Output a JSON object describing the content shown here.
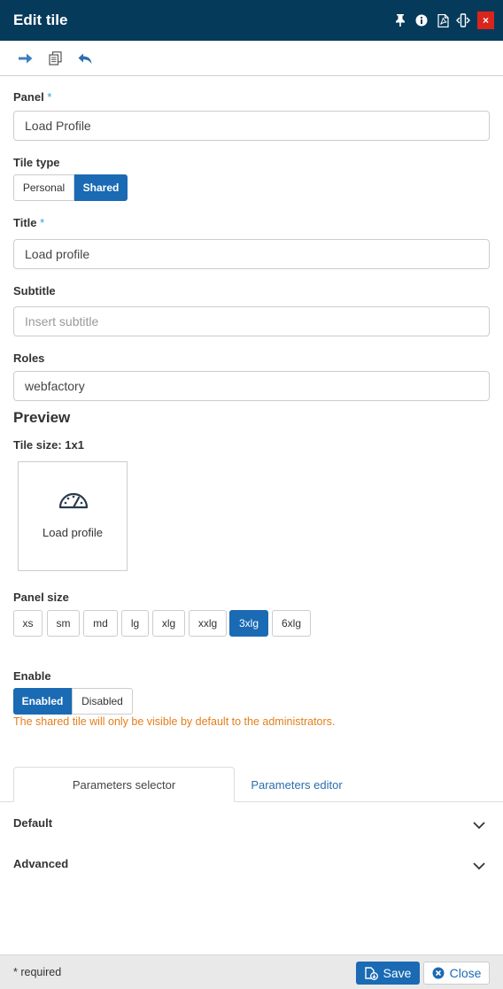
{
  "header": {
    "title": "Edit tile",
    "close_label": "×",
    "icons": [
      "pin-icon",
      "info-icon",
      "pdf-icon",
      "expand-width-icon"
    ]
  },
  "toolbar": {
    "icons": [
      "arrow-right-icon",
      "copy-icon",
      "reply-icon"
    ]
  },
  "form": {
    "panel": {
      "label": "Panel",
      "required_mark": "*",
      "value": "Load Profile"
    },
    "tile_type": {
      "label": "Tile type",
      "options": [
        "Personal",
        "Shared"
      ],
      "selected": "Shared"
    },
    "title": {
      "label": "Title",
      "required_mark": "*",
      "value": "Load profile"
    },
    "subtitle": {
      "label": "Subtitle",
      "placeholder": "Insert subtitle",
      "value": ""
    },
    "roles": {
      "label": "Roles",
      "value": "webfactory"
    }
  },
  "preview": {
    "heading": "Preview",
    "tile_size_label": "Tile size: 1x1",
    "tile": {
      "icon": "speedometer-icon",
      "label": "Load profile"
    }
  },
  "panel_size": {
    "label": "Panel size",
    "options": [
      "xs",
      "sm",
      "md",
      "lg",
      "xlg",
      "xxlg",
      "3xlg",
      "6xlg"
    ],
    "selected": "3xlg"
  },
  "enable": {
    "label": "Enable",
    "options": [
      "Enabled",
      "Disabled"
    ],
    "selected": "Enabled",
    "note": "The shared tile will only be visible by default to the administrators."
  },
  "tabs": [
    {
      "label": "Parameters selector",
      "active": true
    },
    {
      "label": "Parameters editor",
      "active": false
    }
  ],
  "sections": [
    {
      "label": "Default",
      "icon": "chevron-down-icon"
    },
    {
      "label": "Advanced",
      "icon": "chevron-down-icon"
    }
  ],
  "footer": {
    "required_note": "* required",
    "save_label": "Save",
    "close_label": "Close"
  },
  "colors": {
    "header_bg": "#063a5b",
    "accent": "#1a6ab4",
    "close_red": "#d9251c",
    "warning": "#e27f1d"
  }
}
